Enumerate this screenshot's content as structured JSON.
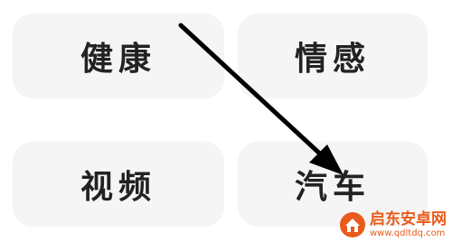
{
  "cards": [
    {
      "label": "健康"
    },
    {
      "label": "情感"
    },
    {
      "label": "视频"
    },
    {
      "label": "汽车"
    }
  ],
  "watermark": {
    "brand": "启东安卓网",
    "url": "www.qdltdq.com",
    "icon": "house-icon"
  },
  "colors": {
    "card_bg": "#f5f5f5",
    "text": "#222222",
    "arrow": "#000000",
    "watermark": "#e85b1c"
  }
}
